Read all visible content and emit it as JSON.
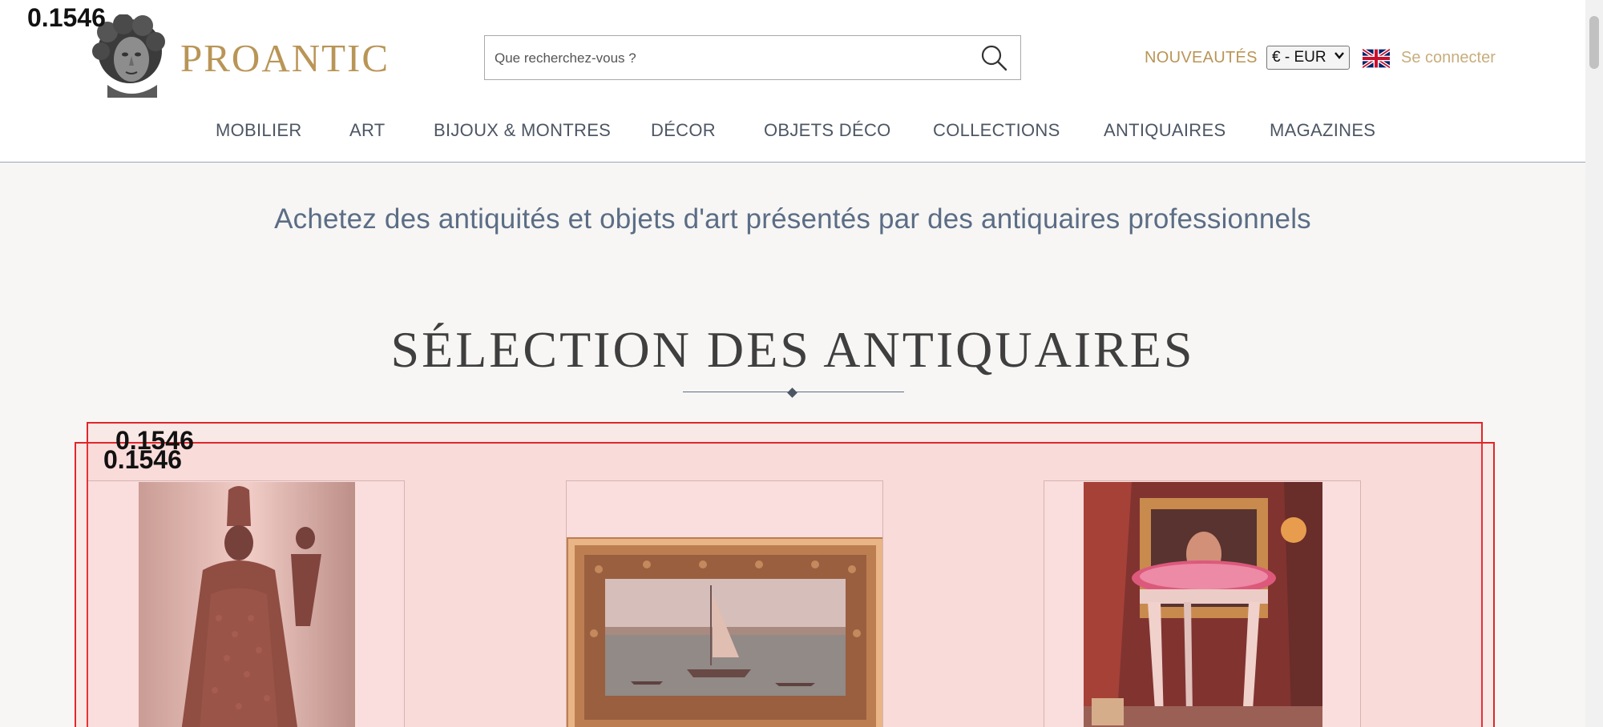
{
  "overlay": {
    "score_label": "0.1546"
  },
  "header": {
    "logo_text": "PROANTIC",
    "search_placeholder": "Que recherchez-vous ?",
    "nouveautes_label": "NOUVEAUTÉS",
    "currency_selected": "€ - EUR",
    "language_flag": "uk-flag-icon",
    "login_label": "Se connecter"
  },
  "nav": {
    "items": [
      "MOBILIER",
      "ART",
      "BIJOUX & MONTRES",
      "DÉCOR",
      "OBJETS DÉCO",
      "COLLECTIONS",
      "ANTIQUAIRES",
      "MAGAZINES"
    ]
  },
  "main": {
    "tagline": "Achetez des antiquités et objets d'art présentés par des antiquaires professionnels",
    "section_title": "SÉLECTION DES ANTIQUAIRES"
  },
  "products": [
    {
      "image": "carved-madonna-statue-image"
    },
    {
      "image": "venetian-lagoon-painting-image"
    },
    {
      "image": "embroidered-footstool-portrait-image"
    }
  ],
  "colors": {
    "accent_gold": "#b99556",
    "nav_text": "#4d5664",
    "tagline_blue": "#5b6d86",
    "highlight_red": "#e0262a"
  }
}
